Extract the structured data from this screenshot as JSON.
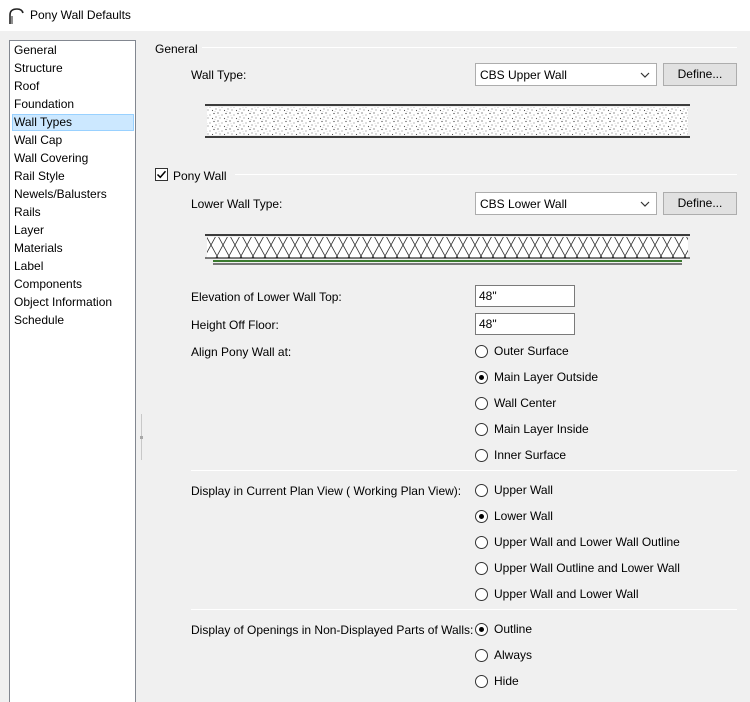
{
  "window": {
    "title": "Pony Wall Defaults"
  },
  "sidebar": {
    "items": [
      {
        "label": "General",
        "selected": false
      },
      {
        "label": "Structure",
        "selected": false
      },
      {
        "label": "Roof",
        "selected": false
      },
      {
        "label": "Foundation",
        "selected": false
      },
      {
        "label": "Wall Types",
        "selected": true
      },
      {
        "label": "Wall Cap",
        "selected": false
      },
      {
        "label": "Wall Covering",
        "selected": false
      },
      {
        "label": "Rail Style",
        "selected": false
      },
      {
        "label": "Newels/Balusters",
        "selected": false
      },
      {
        "label": "Rails",
        "selected": false
      },
      {
        "label": "Layer",
        "selected": false
      },
      {
        "label": "Materials",
        "selected": false
      },
      {
        "label": "Label",
        "selected": false
      },
      {
        "label": "Components",
        "selected": false
      },
      {
        "label": "Object Information",
        "selected": false
      },
      {
        "label": "Schedule",
        "selected": false
      }
    ]
  },
  "general": {
    "heading": "General",
    "wall_type_label": "Wall Type:",
    "wall_type_value": "CBS Upper Wall",
    "define_label": "Define..."
  },
  "pony_wall": {
    "checkbox_label": "Pony Wall",
    "checked": true,
    "lower_wall_type_label": "Lower Wall Type:",
    "lower_wall_type_value": "CBS Lower Wall",
    "define_label": "Define...",
    "elevation_label": "Elevation of Lower Wall Top:",
    "elevation_value": "48\"",
    "height_label": "Height Off Floor:",
    "height_value": "48\""
  },
  "align": {
    "label": "Align Pony Wall at:",
    "options": [
      {
        "label": "Outer Surface",
        "selected": false
      },
      {
        "label": "Main Layer Outside",
        "selected": true
      },
      {
        "label": "Wall Center",
        "selected": false
      },
      {
        "label": "Main Layer Inside",
        "selected": false
      },
      {
        "label": "Inner Surface",
        "selected": false
      }
    ]
  },
  "display_plan": {
    "label": "Display in Current Plan View ( Working Plan View):",
    "options": [
      {
        "label": "Upper Wall",
        "selected": false
      },
      {
        "label": "Lower Wall",
        "selected": true
      },
      {
        "label": "Upper Wall and Lower Wall Outline",
        "selected": false
      },
      {
        "label": "Upper Wall Outline and Lower Wall",
        "selected": false
      },
      {
        "label": "Upper Wall and Lower Wall",
        "selected": false
      }
    ]
  },
  "display_openings": {
    "label": "Display of Openings in Non-Displayed Parts of Walls:",
    "options": [
      {
        "label": "Outline",
        "selected": true
      },
      {
        "label": "Always",
        "selected": false
      },
      {
        "label": "Hide",
        "selected": false
      }
    ]
  },
  "icons": {
    "app": "arch-icon",
    "dropdown": "chevron-down-icon"
  },
  "colors": {
    "selection_bg": "#cce8ff",
    "selection_border": "#99d1ff",
    "lower_wall_green": "#3a7a2e"
  }
}
